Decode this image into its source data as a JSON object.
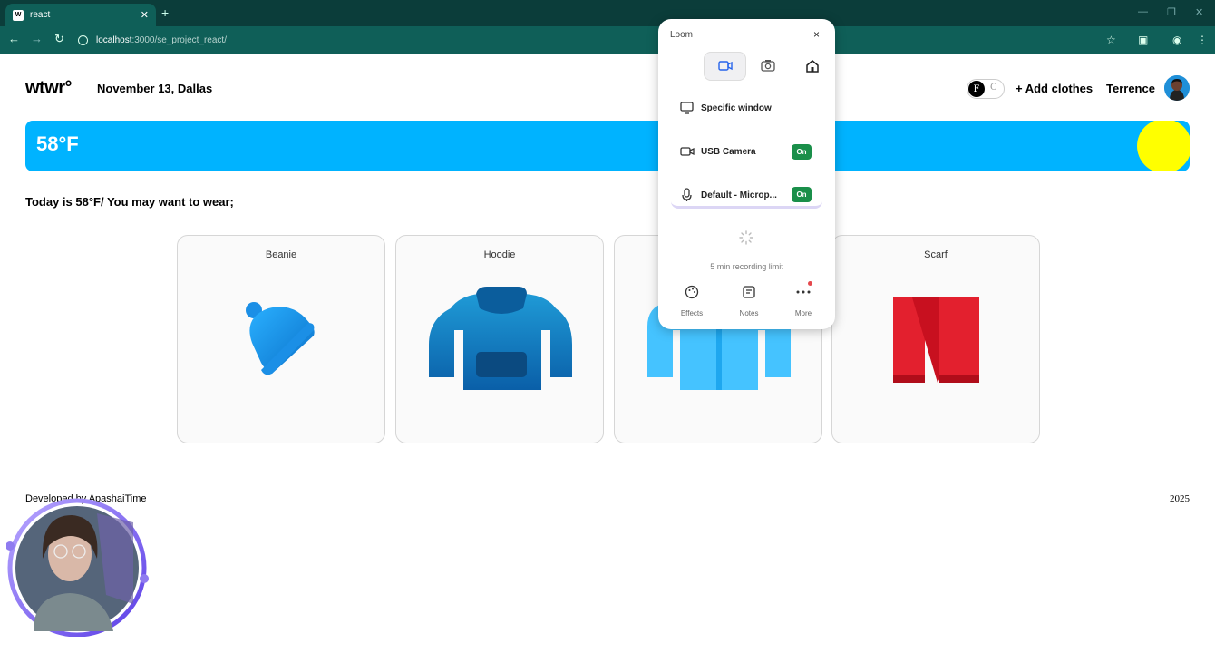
{
  "browser": {
    "tab_title": "react",
    "url_host": "localhost",
    "url_path": ":3000/se_project_react/"
  },
  "header": {
    "logo": "wtwr°",
    "date_location": "November 13, Dallas",
    "toggle_f": "F",
    "toggle_c": "C",
    "add_clothes": "+ Add clothes",
    "username": "Terrence"
  },
  "weather": {
    "temperature": "58°F",
    "banner_color": "#00b3ff",
    "sun_color": "#ffff00"
  },
  "recommendation": "Today is 58°F/ You may want to wear;",
  "items": [
    {
      "name": "Beanie",
      "icon": "beanie-icon"
    },
    {
      "name": "Hoodie",
      "icon": "hoodie-icon"
    },
    {
      "name": "",
      "icon": "jacket-icon"
    },
    {
      "name": "Scarf",
      "icon": "scarf-icon"
    }
  ],
  "footer": {
    "developer": "Developed by ApashaiTime",
    "year": "2025"
  },
  "loom": {
    "title": "Loom",
    "close": "×",
    "source": "Specific window",
    "camera": "USB Camera",
    "camera_state": "On",
    "mic": "Default - Microp...",
    "mic_state": "On",
    "limit": "5 min recording limit",
    "actions": [
      "Effects",
      "Notes",
      "More"
    ]
  }
}
